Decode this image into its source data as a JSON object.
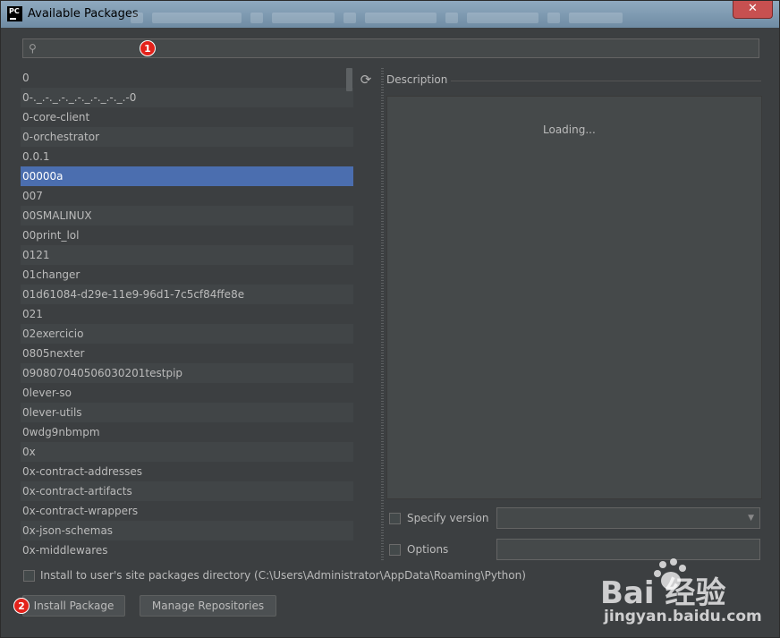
{
  "window": {
    "title": "Available Packages",
    "app_icon_text": "PC"
  },
  "search": {
    "placeholder": "",
    "value": ""
  },
  "badges": {
    "search_marker": "1",
    "install_marker": "2"
  },
  "packages": [
    "0",
    "0-._.-._.-._.-._.-._.-._.-0",
    "0-core-client",
    "0-orchestrator",
    "0.0.1",
    "00000a",
    "007",
    "00SMALINUX",
    "00print_lol",
    "0121",
    "01changer",
    "01d61084-d29e-11e9-96d1-7c5cf84ffe8e",
    "021",
    "02exercicio",
    "0805nexter",
    "090807040506030201testpip",
    "0lever-so",
    "0lever-utils",
    "0wdg9nbmpm",
    "0x",
    "0x-contract-addresses",
    "0x-contract-artifacts",
    "0x-contract-wrappers",
    "0x-json-schemas",
    "0x-middlewares"
  ],
  "selected_index": 5,
  "description": {
    "label": "Description",
    "status": "Loading..."
  },
  "options": {
    "specify_version_label": "Specify version",
    "specify_version_checked": false,
    "version_value": "",
    "options_label": "Options",
    "options_checked": false,
    "options_value": "",
    "install_user_label": "Install to user's site packages directory (C:\\Users\\Administrator\\AppData\\Roaming\\Python)",
    "install_user_checked": false
  },
  "buttons": {
    "install": "Install Package",
    "manage": "Manage Repositories"
  },
  "watermark": {
    "logo": "Bai  经验",
    "url": "jingyan.baidu.com"
  },
  "colors": {
    "background": "#3c3f41",
    "selection": "#4b6eaf",
    "text": "#bbbbbb",
    "badge": "#e3221b"
  }
}
